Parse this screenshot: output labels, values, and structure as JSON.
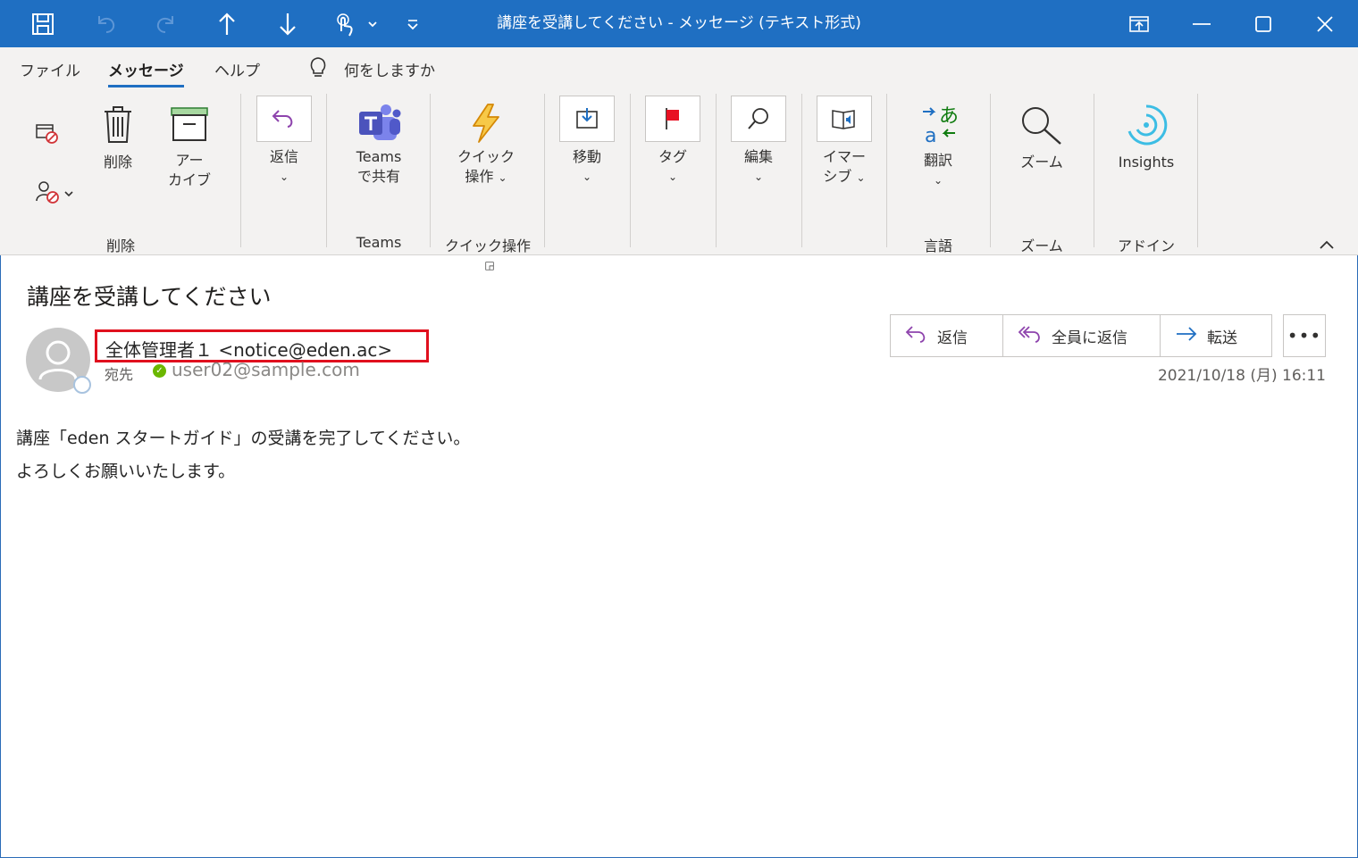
{
  "window": {
    "title": "講座を受講してください - メッセージ (テキスト形式)",
    "colors": {
      "titlebar": "#1f6fc2",
      "accent": "#1f6fc2",
      "highlight_box": "#e0101e"
    },
    "quick_access": [
      "save-icon",
      "undo-icon",
      "redo-icon",
      "previous-item-icon",
      "next-item-icon",
      "touch-mode-icon",
      "customize-qat-icon"
    ],
    "controls": [
      "ribbon-display-options-icon",
      "minimize-icon",
      "maximize-icon",
      "close-icon"
    ]
  },
  "tabs": {
    "file": "ファイル",
    "message": "メッセージ",
    "help": "ヘルプ",
    "tell_me": "何をしますか"
  },
  "ribbon": {
    "delete": "削除",
    "archive_line1": "アー",
    "archive_line2": "カイブ",
    "reply": "返信",
    "teams_line1": "Teams",
    "teams_line2": "で共有",
    "quick_line1": "クイック",
    "quick_line2": "操作",
    "move": "移動",
    "tags": "タグ",
    "edit": "編集",
    "immersive_line1": "イマー",
    "immersive_line2": "シブ",
    "translate": "翻訳",
    "zoom": "ズーム",
    "insights": "Insights",
    "groups": {
      "delete": "削除",
      "teams": "Teams",
      "quick": "クイック操作",
      "language": "言語",
      "zoom": "ズーム",
      "addin": "アドイン"
    }
  },
  "message": {
    "subject": "講座を受講してください",
    "sender": "全体管理者１ <notice@eden.ac>",
    "to_label": "宛先",
    "to_address": "user02@sample.com",
    "datetime": "2021/10/18 (月) 16:11",
    "actions": {
      "reply": "返信",
      "reply_all": "全員に返信",
      "forward": "転送",
      "more": "•••"
    },
    "body_line1": "講座「eden スタートガイド」の受講を完了してください。",
    "body_line2": "よろしくお願いいたします。"
  }
}
